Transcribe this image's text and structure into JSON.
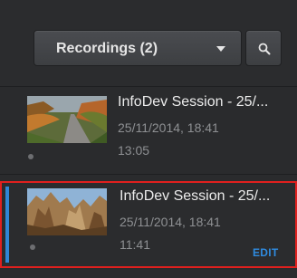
{
  "toolbar": {
    "dropdown_label": "Recordings (2)",
    "dropdown_icon": "caret-down-icon",
    "search_icon": "search-icon"
  },
  "recordings": [
    {
      "title": "InfoDev Session - 25/...",
      "date": "25/11/2014, 18:41",
      "duration": "13:05",
      "thumbnail": "road-autumn-thumbnail",
      "selected": false
    },
    {
      "title": "InfoDev Session - 25/...",
      "date": "25/11/2014, 18:41",
      "duration": "11:41",
      "thumbnail": "rock-cliff-thumbnail",
      "selected": true,
      "action_label": "EDIT"
    }
  ],
  "colors": {
    "background": "#2b2c2e",
    "accent_blue": "#2f86d6",
    "selection_red": "#e0201e"
  }
}
